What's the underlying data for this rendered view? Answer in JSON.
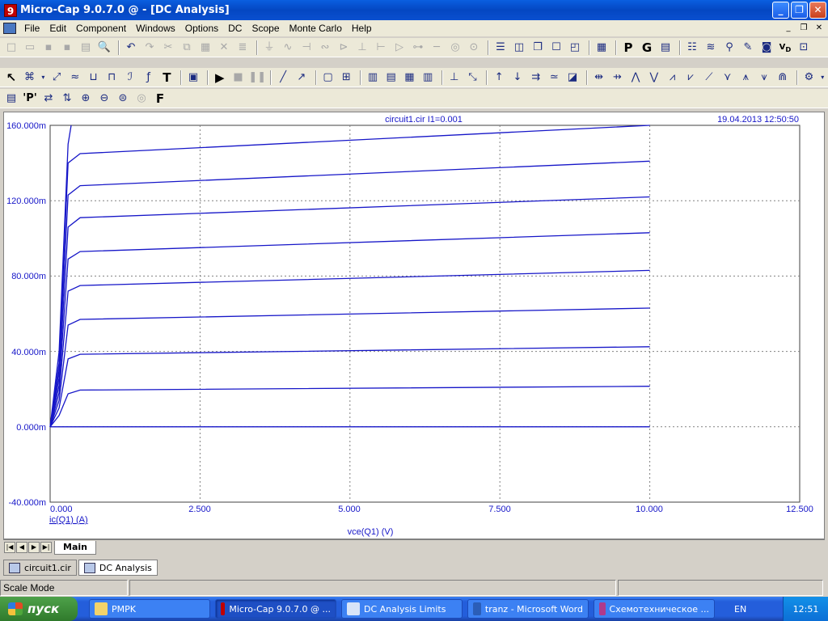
{
  "window": {
    "title": "Micro-Cap 9.0.7.0 @ - [DC Analysis]",
    "app_icon": "9"
  },
  "menu": [
    "File",
    "Edit",
    "Component",
    "Windows",
    "Options",
    "DC",
    "Scope",
    "Monte Carlo",
    "Help"
  ],
  "plot": {
    "header_center": "circuit1.cir I1=0.001",
    "header_right": "19.04.2013 12:50:50",
    "y_tick_labels": [
      "160.000m",
      "120.000m",
      "80.000m",
      "40.000m",
      "0.000m",
      "-40.000m"
    ],
    "x_tick_labels": [
      "0.000",
      "2.500",
      "5.000",
      "7.500",
      "10.000",
      "12.500"
    ],
    "y_axis_label": "ic(Q1) (A)",
    "x_axis_label": "vce(Q1) (V)",
    "colors": {
      "trace": "#1616c8",
      "axis_text": "#1616c8",
      "grid": "#808080"
    }
  },
  "chart_data": {
    "type": "line",
    "xlabel": "vce(Q1) (V)",
    "ylabel": "ic(Q1) (A)",
    "xlim": [
      0,
      12.5
    ],
    "ylim": [
      -0.04,
      0.16
    ],
    "x_ticks": [
      0,
      2.5,
      5,
      7.5,
      10,
      12.5
    ],
    "y_ticks": [
      -0.04,
      0,
      0.04,
      0.08,
      0.12,
      0.16
    ],
    "grid": true,
    "series": [
      {
        "saturation": 0.0,
        "x": [
          0,
          10
        ],
        "y": [
          0,
          0
        ]
      },
      {
        "saturation": 0.0195,
        "x": [
          0,
          0.15,
          0.3,
          0.5,
          10
        ],
        "y": [
          0,
          0.006,
          0.0175,
          0.0195,
          0.0215
        ]
      },
      {
        "saturation": 0.0385,
        "x": [
          0,
          0.15,
          0.3,
          0.5,
          10
        ],
        "y": [
          0,
          0.01,
          0.036,
          0.0385,
          0.0425
        ]
      },
      {
        "saturation": 0.057,
        "x": [
          0,
          0.15,
          0.3,
          0.5,
          10
        ],
        "y": [
          0,
          0.014,
          0.054,
          0.057,
          0.063
        ]
      },
      {
        "saturation": 0.075,
        "x": [
          0,
          0.15,
          0.3,
          0.5,
          10
        ],
        "y": [
          0,
          0.018,
          0.072,
          0.075,
          0.083
        ]
      },
      {
        "saturation": 0.093,
        "x": [
          0,
          0.15,
          0.3,
          0.5,
          10
        ],
        "y": [
          0,
          0.022,
          0.089,
          0.093,
          0.103
        ]
      },
      {
        "saturation": 0.111,
        "x": [
          0,
          0.15,
          0.3,
          0.5,
          10
        ],
        "y": [
          0,
          0.026,
          0.106,
          0.111,
          0.122
        ]
      },
      {
        "saturation": 0.128,
        "x": [
          0,
          0.15,
          0.3,
          0.5,
          10
        ],
        "y": [
          0,
          0.03,
          0.123,
          0.128,
          0.141
        ]
      },
      {
        "saturation": 0.145,
        "x": [
          0,
          0.15,
          0.3,
          0.5,
          10
        ],
        "y": [
          0,
          0.034,
          0.14,
          0.145,
          0.16
        ]
      },
      {
        "saturation": 0.16,
        "x": [
          0,
          0.15,
          0.3,
          0.35
        ],
        "y": [
          0,
          0.04,
          0.15,
          0.16
        ]
      }
    ]
  },
  "tabs": {
    "main": "Main"
  },
  "doc_tabs": [
    "circuit1.cir",
    "DC Analysis"
  ],
  "status": {
    "mode": "Scale Mode"
  },
  "taskbar": {
    "start": "пуск",
    "items": [
      "PMPK",
      "Micro-Cap 9.0.7.0 @ ...",
      "DC Analysis Limits",
      "tranz - Microsoft Word",
      "Схемотехническое ..."
    ],
    "lang": "EN",
    "clock": "12:51"
  }
}
